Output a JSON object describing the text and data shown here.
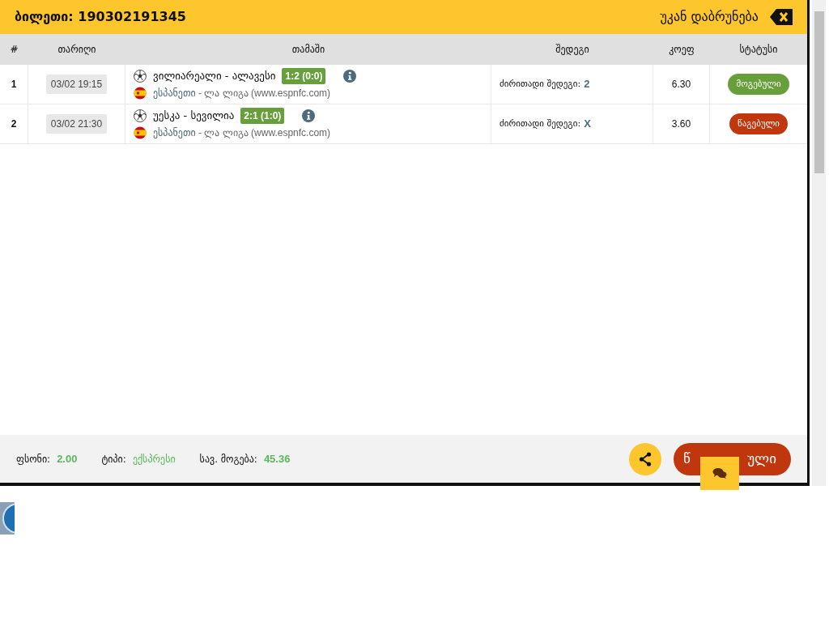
{
  "header": {
    "title": "ბილეთი: 190302191345",
    "back": "უკან დაბრუნება"
  },
  "table": {
    "columns": [
      "#",
      "თარიღი",
      "თამაში",
      "შედეგი",
      "კოეფ",
      "სტატუსი"
    ],
    "rows": [
      {
        "index": "1",
        "date": "03/02 19:15",
        "match": "ვილიარეალი - ალავესი",
        "score": "1:2 (0:0)",
        "country": "ესპანეთი",
        "league": "- ლა ლიგა (www.espnfc.com)",
        "result_label": "ძირითადი შედეგი:",
        "result_value": "2",
        "coef": "6.30",
        "status": {
          "kind": "won",
          "label": "მოგებული"
        }
      },
      {
        "index": "2",
        "date": "03/02 21:30",
        "match": "უესკა - სევილია",
        "score": "2:1 (1:0)",
        "country": "ესპანეთი",
        "league": "- ლა ლიგა (www.espnfc.com)",
        "result_label": "ძირითადი შედეგი:",
        "result_value": "X",
        "coef": "3.60",
        "status": {
          "kind": "lost",
          "label": "წაგებული"
        }
      }
    ]
  },
  "footer": {
    "stake_label": "ფსონი:",
    "stake": "2.00",
    "type_label": "ტიპი:",
    "type": "ექსპრესი",
    "payout_label": "სავ. მოგება:",
    "payout": "45.36",
    "status_button": {
      "visible_start": "წ",
      "visible_end": "ული"
    }
  }
}
